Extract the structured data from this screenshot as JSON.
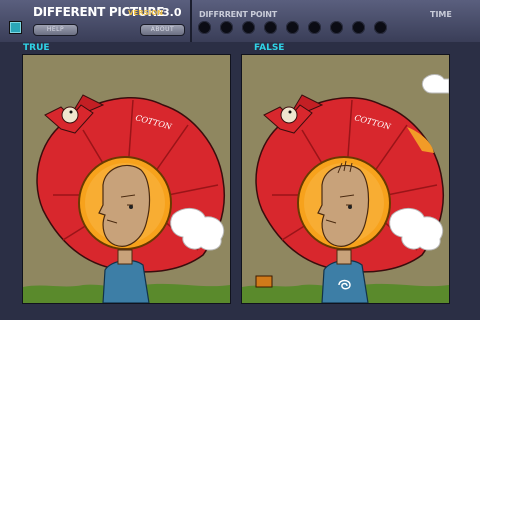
{
  "header": {
    "title": "DIFFERENT PICTURE",
    "version_label": "VERSION",
    "version_number": "3.0",
    "help_label": "HELP",
    "about_label": "ABOUT",
    "difference_point_label": "DIFFRRENT POINT",
    "time_label": "TIME",
    "difference_slots_found": 0,
    "difference_slots_total": 9
  },
  "panels": {
    "left_label": "TRUE",
    "right_label": "FALSE",
    "umbrella_text": "COTTON"
  },
  "colors": {
    "background": "#2b2f45",
    "accent_label": "#2fd3e6",
    "version_accent": "#f0c24a",
    "umbrella_red": "#d8272d",
    "helmet_orange": "#f7a21c",
    "sky_olive": "#8f8760",
    "grass_green": "#5a8a2c"
  }
}
